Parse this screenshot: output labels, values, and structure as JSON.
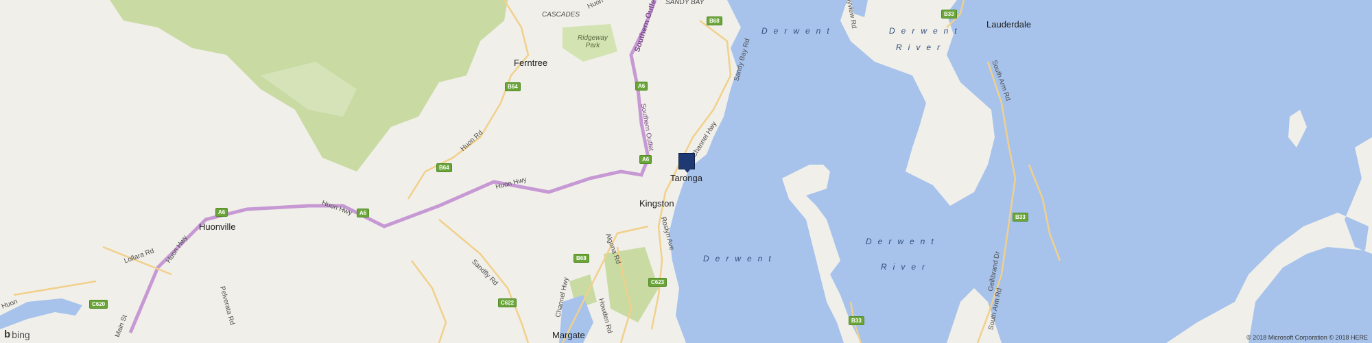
{
  "map": {
    "provider_logo": "bing",
    "attribution": "© 2018 Microsoft Corporation © 2018 HERE",
    "marker": {
      "label": "Taronga",
      "icon": "location-pin-icon"
    },
    "colors": {
      "water": "#a7c3ec",
      "land": "#f1efe9",
      "forest": "#c9dba3",
      "park": "#d3e3b2",
      "highway": "#c699d4",
      "road": "#f1d08a",
      "shield": "#6ba53a"
    }
  },
  "towns": {
    "lauderdale": "Lauderdale",
    "ferntree": "Ferntree",
    "taronga": "Taronga",
    "kingston": "Kingston",
    "huonville": "Huonville",
    "margate": "Margate"
  },
  "areas": {
    "cascades": "CASCADES",
    "sandy_bay": "SANDY BAY",
    "ridgeway_park": "Ridgeway\nPark"
  },
  "water": {
    "derwent_top": "Derwent",
    "derwent_river_top": "Derwent",
    "river_top": "River",
    "derwent_mid": "Derwent",
    "river_mid": "River",
    "derwent_left": "Derwent"
  },
  "roads": {
    "southern_outlet": "Southern Outlet",
    "southern_outlet_lower": "Southern Outlet",
    "huon_rd": "Huon Rd",
    "huon_rd_top": "Huon",
    "huon_hwy_1": "Huon Hwy",
    "huon_hwy_2": "Huon Hwy",
    "huon_hwy_3": "Huon Hwy",
    "channel_hwy_top": "Channel Hwy",
    "channel_hwy_bottom": "Channel Hwy",
    "sandy_bay_rd": "Sandy Bay Rd",
    "roslyn_ave": "Roslyn Ave",
    "algona_rd": "Algona Rd",
    "howden_rd": "Howden Rd",
    "sandfly_rd": "Sandfly Rd",
    "pelverata_rd": "Pelverata Rd",
    "lollara_rd": "Lollara Rd",
    "south_arm_rd_1": "South Arm Rd",
    "south_arm_rd_2": "South Arm Rd",
    "gellibrand_dr": "Gellibrand Dr",
    "bayview_rd": "Bayview Rd",
    "main_st": "Main St",
    "huon_left": "Huon"
  },
  "shields": {
    "b68_top": "B68",
    "b33_top": "B33",
    "b64_a": "B64",
    "b64_b": "B64",
    "a6_a": "A6",
    "a6_b": "A6",
    "a6_c": "A6",
    "a6_d": "A6",
    "b68_bottom": "B68",
    "c623": "C623",
    "c622": "C622",
    "c620": "C620",
    "b33_mid": "B33",
    "b33_bottom": "B33"
  }
}
